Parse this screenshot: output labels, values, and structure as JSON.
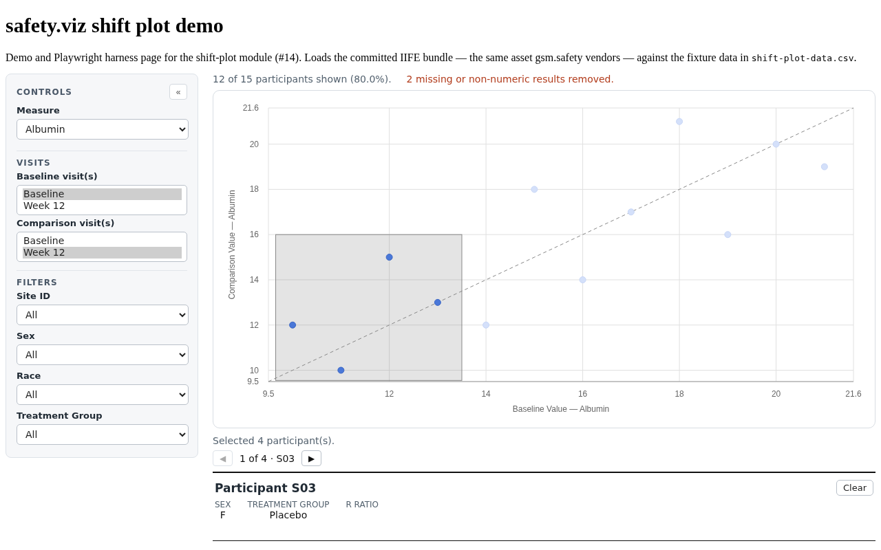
{
  "title": "safety.viz shift plot demo",
  "description": {
    "text": "Demo and Playwright harness page for the shift-plot module (#14). Loads the committed IIFE bundle — the same asset gsm.safety vendors — against the fixture data in",
    "code": "shift-plot-data.csv",
    "end": "."
  },
  "sidebar": {
    "heading": "CONTROLS",
    "collapse": "«",
    "sections": [
      {
        "fields": [
          {
            "kind": "select",
            "label": "Measure",
            "value": "Albumin"
          }
        ]
      },
      {
        "heading": "VISITS",
        "fields": [
          {
            "kind": "listbox",
            "label": "Baseline visit(s)",
            "options": [
              {
                "label": "Baseline",
                "selected": true
              },
              {
                "label": "Week 12",
                "selected": false
              }
            ]
          },
          {
            "kind": "listbox",
            "label": "Comparison visit(s)",
            "options": [
              {
                "label": "Baseline",
                "selected": false
              },
              {
                "label": "Week 12",
                "selected": true
              }
            ]
          }
        ]
      },
      {
        "heading": "FILTERS",
        "fields": [
          {
            "kind": "select",
            "label": "Site ID",
            "value": "All"
          },
          {
            "kind": "select",
            "label": "Sex",
            "value": "All"
          },
          {
            "kind": "select",
            "label": "Race",
            "value": "All"
          },
          {
            "kind": "select",
            "label": "Treatment Group",
            "value": "All"
          }
        ]
      }
    ]
  },
  "summary": "12 of 15 participants shown (80.0%).",
  "warning": "2 missing or non-numeric results removed.",
  "chart": {
    "chart_data": {
      "type": "scatter",
      "xlabel": "Baseline Value — Albumin",
      "ylabel": "Comparison Value — Albumin",
      "xlim": [
        9.5,
        21.6
      ],
      "ylim": [
        9.5,
        21.6
      ],
      "xticks": [
        9.5,
        12,
        14,
        16,
        18,
        20,
        21.6
      ],
      "yticks": [
        9.5,
        10,
        12,
        14,
        16,
        18,
        20,
        21.6
      ],
      "x": [
        9.5,
        10,
        11,
        12,
        13,
        14,
        15,
        16,
        17,
        18,
        19,
        20,
        21,
        21.6
      ],
      "series": [
        {
          "color": "#4a78d8",
          "values": [
            null,
            12,
            10,
            15,
            13,
            null,
            null,
            null,
            null,
            null,
            null,
            null,
            null,
            null
          ]
        },
        {
          "color": "#d4e0fa",
          "values": [
            null,
            null,
            null,
            null,
            null,
            12,
            18,
            14,
            17,
            21,
            16,
            20,
            19,
            null
          ]
        },
        {
          "type": "line",
          "color": "#888888",
          "line_style": "dashed",
          "values": [
            9.5,
            10,
            11,
            12,
            13,
            14,
            15,
            16,
            17,
            18,
            19,
            20,
            21,
            21.6
          ]
        }
      ],
      "grid": true
    }
  },
  "selection": {
    "text": "Selected 4 participant(s).",
    "prev": "◀",
    "prev_disabled": true,
    "position": "1 of 4 · S03",
    "next": "▶",
    "next_disabled": false
  },
  "participant": {
    "title": "Participant S03",
    "clear": "Clear",
    "fields": [
      {
        "label": "SEX",
        "value": "F"
      },
      {
        "label": "TREATMENT GROUP",
        "value": "Placebo"
      },
      {
        "label": "R RATIO"
      }
    ]
  }
}
